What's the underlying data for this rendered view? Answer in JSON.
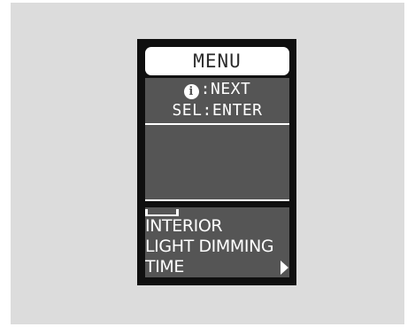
{
  "display": {
    "title": "MENU",
    "hint_next_icon": "info-icon",
    "hint_next": ":NEXT",
    "hint_enter": "SEL:ENTER"
  },
  "menu": {
    "items": [
      {
        "label": "INTERIOR"
      },
      {
        "label": "LIGHT DIMMING"
      },
      {
        "label": "TIME"
      }
    ],
    "submenu_arrow_icon": "chevron-right-icon"
  },
  "colors": {
    "background": "#dcdcdc",
    "screen_bezel": "#0f0f0f",
    "screen_gray": "#555555",
    "text": "#ffffff"
  }
}
